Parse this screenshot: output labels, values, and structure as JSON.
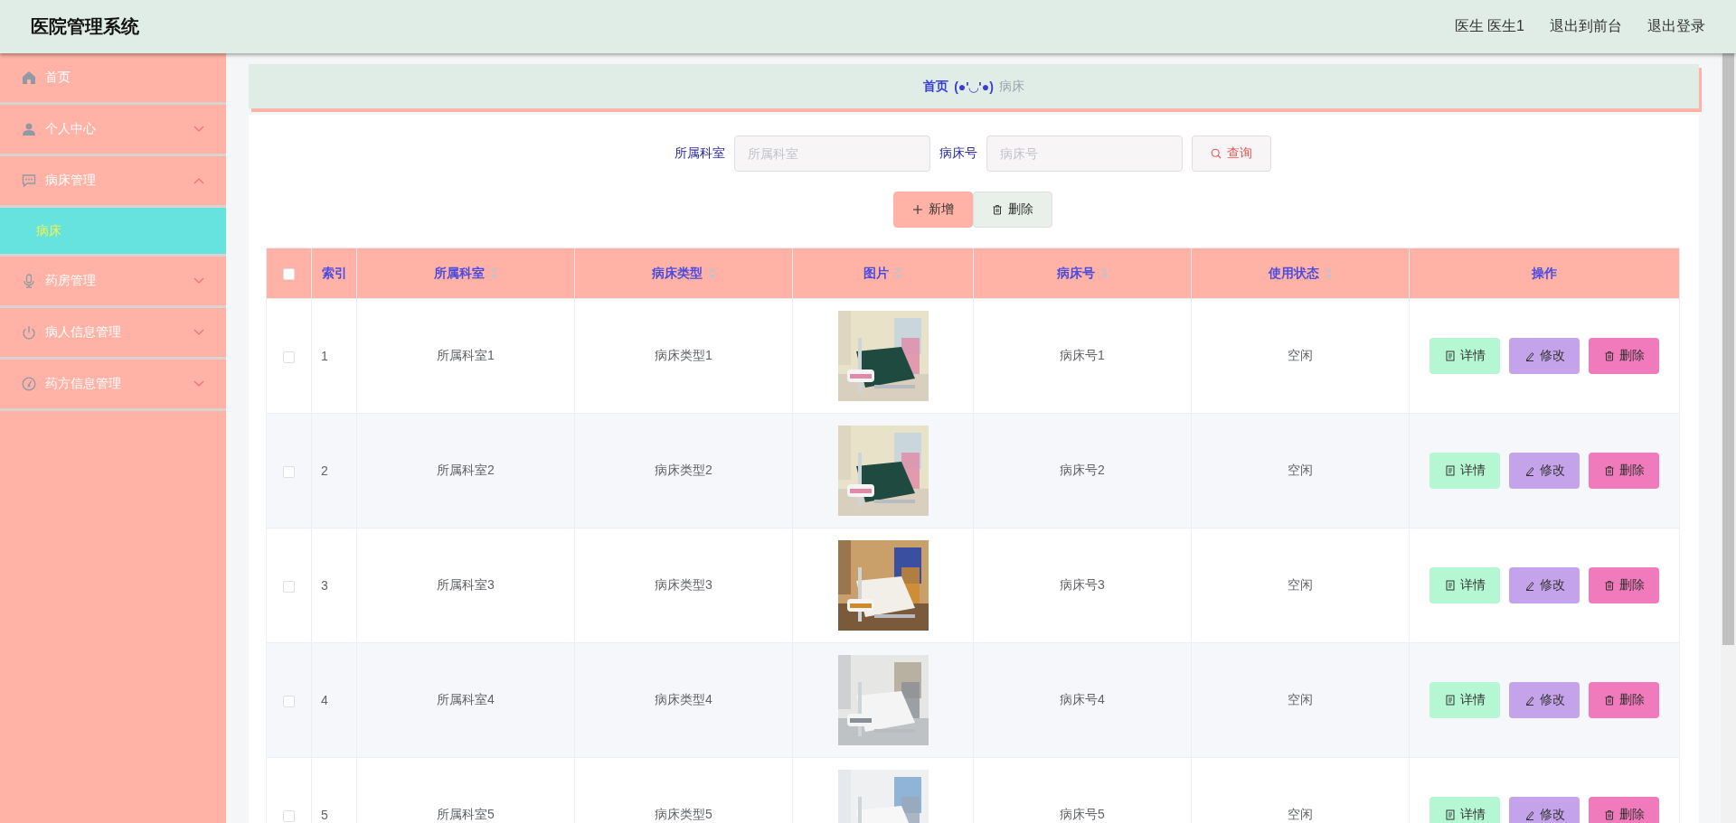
{
  "header": {
    "title": "医院管理系统",
    "user": "医生 医生1",
    "links": [
      "退出到前台",
      "退出登录"
    ]
  },
  "sidebar": {
    "items": [
      {
        "kind": "link",
        "label": "首页",
        "selected": false
      },
      {
        "kind": "menu",
        "label": "个人中心",
        "expanded": false
      },
      {
        "kind": "menu",
        "label": "病床管理",
        "expanded": true,
        "children": [
          {
            "label": "病床",
            "selected": true
          }
        ]
      },
      {
        "kind": "menu",
        "label": "药房管理",
        "expanded": false
      },
      {
        "kind": "menu",
        "label": "病人信息管理",
        "expanded": false
      },
      {
        "kind": "menu",
        "label": "药方信息管理",
        "expanded": false
      }
    ]
  },
  "breadcrumb": {
    "home": "首页",
    "separator": "(●'◡'●)",
    "current": "病床"
  },
  "search": {
    "fields": [
      {
        "label": "所属科室",
        "placeholder": "所属科室"
      },
      {
        "label": "病床号",
        "placeholder": "病床号"
      }
    ],
    "button": "查询"
  },
  "actions": {
    "add": "新增",
    "delete": "删除"
  },
  "table": {
    "all_checked": false,
    "columns": [
      {
        "label": "索引",
        "sortable": false
      },
      {
        "label": "所属科室",
        "sortable": true
      },
      {
        "label": "病床类型",
        "sortable": true
      },
      {
        "label": "图片",
        "sortable": true
      },
      {
        "label": "病床号",
        "sortable": true
      },
      {
        "label": "使用状态",
        "sortable": true
      },
      {
        "label": "操作",
        "sortable": false
      }
    ],
    "rows": [
      {
        "checked": false,
        "index": "1",
        "department": "所属科室1",
        "bed_type": "病床类型1",
        "bed_no": "病床号1",
        "status": "空闲",
        "buttons": [
          "详情",
          "修改",
          "删除"
        ]
      },
      {
        "checked": false,
        "index": "2",
        "department": "所属科室2",
        "bed_type": "病床类型2",
        "bed_no": "病床号2",
        "status": "空闲",
        "buttons": [
          "详情",
          "修改",
          "删除"
        ]
      },
      {
        "checked": false,
        "index": "3",
        "department": "所属科室3",
        "bed_type": "病床类型3",
        "bed_no": "病床号3",
        "status": "空闲",
        "buttons": [
          "详情",
          "修改",
          "删除"
        ]
      },
      {
        "checked": false,
        "index": "4",
        "department": "所属科室4",
        "bed_type": "病床类型4",
        "bed_no": "病床号4",
        "status": "空闲",
        "buttons": [
          "详情",
          "修改",
          "删除"
        ]
      },
      {
        "checked": false,
        "index": "5",
        "department": "所属科室5",
        "bed_type": "病床类型5",
        "bed_no": "病床号5",
        "status": "空闲",
        "buttons": [
          "详情",
          "修改",
          "删除"
        ]
      }
    ]
  }
}
